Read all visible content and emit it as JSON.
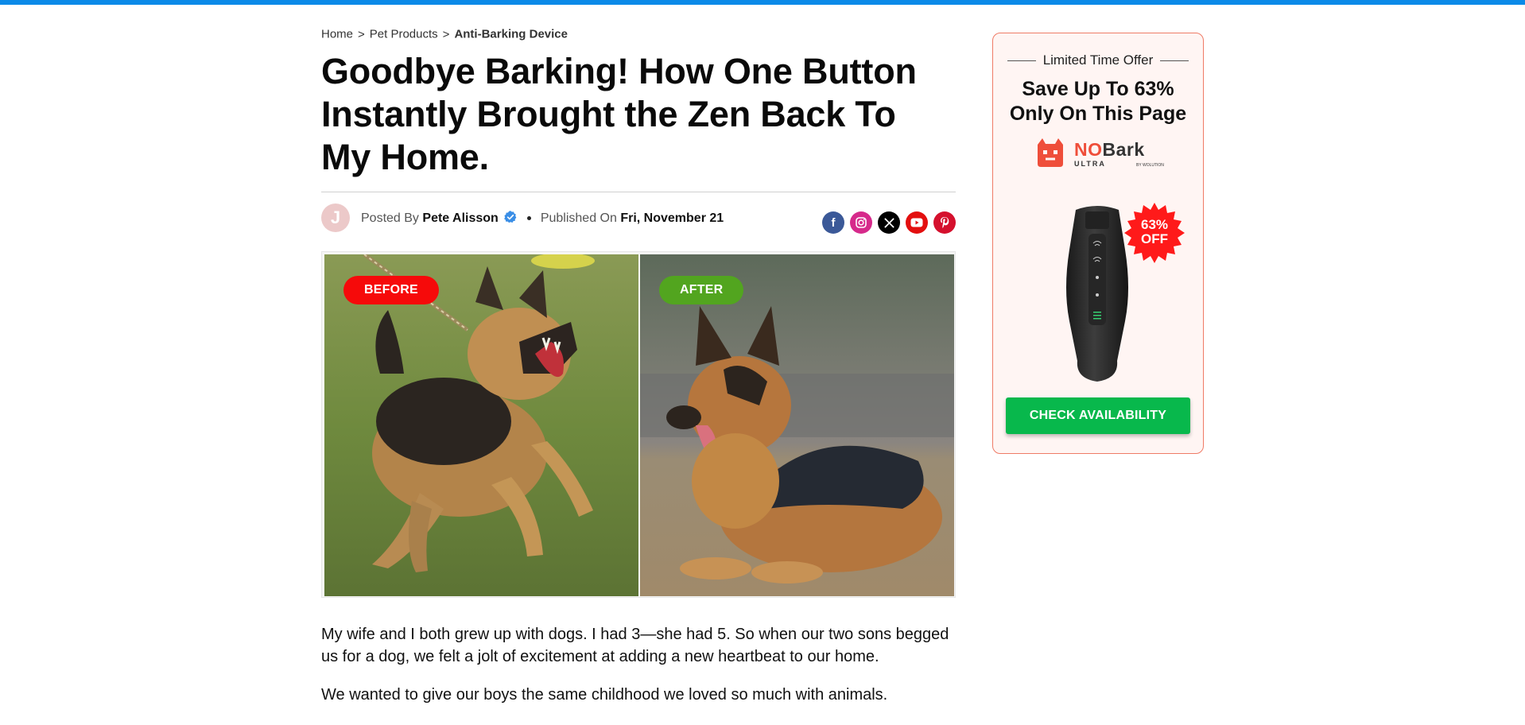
{
  "theme": {
    "accent_bar": "#0b8ae8",
    "badge_before": "#f60a0a",
    "badge_after": "#52a51f",
    "cta": "#08b84c",
    "offer_border": "#ef7b66",
    "offer_bg": "#fff5f3"
  },
  "breadcrumb": {
    "items": [
      "Home",
      "Pet Products",
      "Anti-Barking Device"
    ],
    "separator": ">"
  },
  "article": {
    "title": "Goodbye Barking! How One Button Instantly Brought the Zen Back To My Home.",
    "author_initial": "J",
    "posted_by_label": "Posted By",
    "author": "Pete Alisson",
    "published_label": "Published On",
    "published_date": "Fri, November 21",
    "verified_icon": "verified-check-icon",
    "social_icons": [
      "facebook-icon",
      "instagram-icon",
      "x-icon",
      "youtube-icon",
      "pinterest-icon"
    ],
    "image": {
      "before_label": "BEFORE",
      "after_label": "AFTER"
    },
    "paragraphs": [
      "My wife and I both grew up with dogs. I had 3—she had 5. So when our two sons begged us for a dog, we felt a jolt of excitement at adding a new heartbeat to our home.",
      "We wanted to give our boys the same childhood we loved so much with animals."
    ]
  },
  "offer": {
    "kicker": "Limited Time Offer",
    "headline_line1": "Save Up To 63%",
    "headline_line2": "Only On This Page",
    "brand_no": "NO",
    "brand_bark": "Bark",
    "brand_sub": "ULTRA",
    "brand_by": "BY WOLUTION",
    "discount_line1": "63%",
    "discount_line2": "OFF",
    "cta_label": "CHECK AVAILABILITY"
  }
}
